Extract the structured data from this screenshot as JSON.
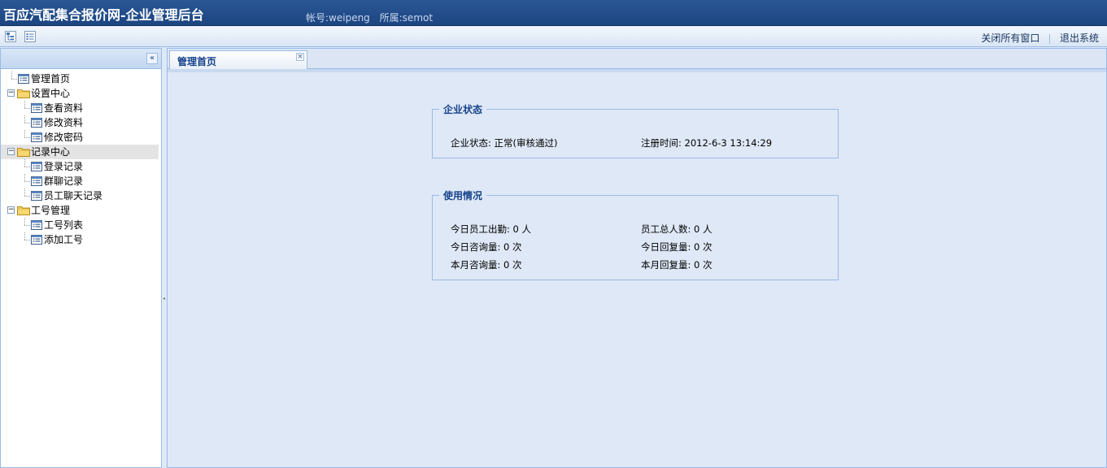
{
  "header": {
    "title": "百应汽配集合报价网-企业管理后台",
    "account": "帐号:weipeng",
    "belongs": "所属:semot"
  },
  "toolbar": {
    "close_all": "关闭所有窗口",
    "logout": "退出系统",
    "icon_left": "tree-view-icon",
    "icon_right": "list-view-icon"
  },
  "sidebar": {
    "collapse_symbol": "«",
    "tree": [
      {
        "label": "管理首页",
        "type": "leaf",
        "level": 0
      },
      {
        "label": "设置中心",
        "type": "folder",
        "level": 0
      },
      {
        "label": "查看资料",
        "type": "leaf",
        "level": 1
      },
      {
        "label": "修改资料",
        "type": "leaf",
        "level": 1
      },
      {
        "label": "修改密码",
        "type": "leaf",
        "level": 1
      },
      {
        "label": "记录中心",
        "type": "folder",
        "level": 0,
        "selected": true
      },
      {
        "label": "登录记录",
        "type": "leaf",
        "level": 1
      },
      {
        "label": "群聊记录",
        "type": "leaf",
        "level": 1
      },
      {
        "label": "员工聊天记录",
        "type": "leaf",
        "level": 1
      },
      {
        "label": "工号管理",
        "type": "folder",
        "level": 0
      },
      {
        "label": "工号列表",
        "type": "leaf",
        "level": 1
      },
      {
        "label": "添加工号",
        "type": "leaf",
        "level": 1
      }
    ]
  },
  "tabs": [
    {
      "label": "管理首页",
      "active": true,
      "close_symbol": "×"
    }
  ],
  "status_box": {
    "legend": "企业状态",
    "status_label": "企业状态:",
    "status_value": "正常(审核通过)",
    "reg_label": "注册时间:",
    "reg_value": "2012-6-3 13:14:29"
  },
  "usage_box": {
    "legend": "使用情况",
    "today_attendance": "今日员工出勤: 0 人",
    "total_staff": "员工总人数: 0 人",
    "today_consult": "今日咨询量: 0 次",
    "today_reply": "今日回复量: 0 次",
    "month_consult": "本月咨询量: 0 次",
    "month_reply": "本月回复量: 0 次"
  },
  "colors": {
    "header_bg": "#1c4581",
    "accent": "#15428b",
    "border": "#99bbe8"
  }
}
